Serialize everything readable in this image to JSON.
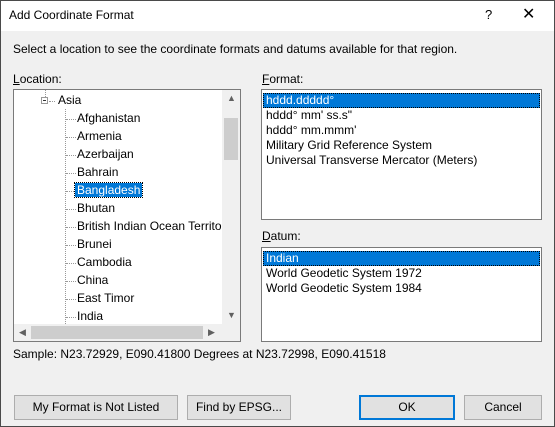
{
  "window": {
    "title": "Add Coordinate Format",
    "help": "?",
    "close": "✕"
  },
  "description": "Select a location to see the coordinate formats and datums available for that region.",
  "location": {
    "label_accel": "L",
    "label_rest": "ocation:",
    "parent": "Asia",
    "items": [
      "Afghanistan",
      "Armenia",
      "Azerbaijan",
      "Bahrain",
      "Bangladesh",
      "Bhutan",
      "British Indian Ocean Territor",
      "Brunei",
      "Cambodia",
      "China",
      "East Timor",
      "India"
    ],
    "selected": "Bangladesh"
  },
  "format": {
    "label_accel": "F",
    "label_rest": "ormat:",
    "items": [
      "hddd.ddddd°",
      "hddd° mm' ss.s\"",
      "hddd° mm.mmm'",
      "Military Grid Reference System",
      "Universal Transverse Mercator (Meters)"
    ],
    "selected": "hddd.ddddd°"
  },
  "datum": {
    "label_accel": "D",
    "label_rest": "atum:",
    "items": [
      "Indian",
      "World Geodetic System 1972",
      "World Geodetic System 1984"
    ],
    "selected": "Indian"
  },
  "sample": "Sample: N23.72929, E090.41800 Degrees at N23.72998, E090.41518",
  "buttons": {
    "not_listed": "My Format is Not Listed",
    "find_epsg": "Find by EPSG...",
    "ok": "OK",
    "cancel": "Cancel"
  },
  "colors": {
    "selection": "#0078d7",
    "dialog_bg": "#f0f0f0"
  }
}
